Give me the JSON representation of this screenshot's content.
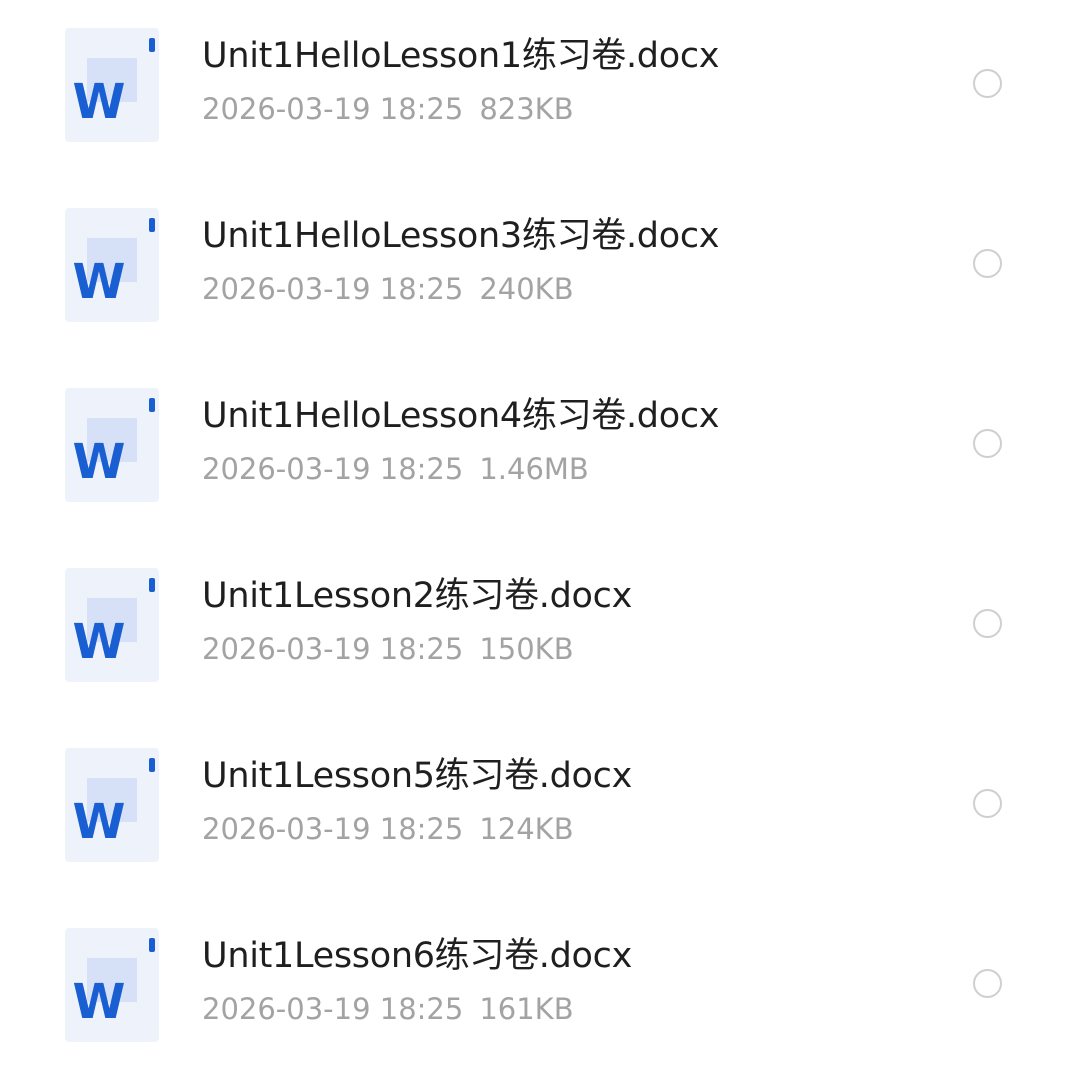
{
  "files": [
    {
      "name": "Unit1HelloLesson1练习卷.docx",
      "date": "2026-03-19 18:25",
      "size": "823KB",
      "icon": "word-document-icon",
      "icon_letter": "W"
    },
    {
      "name": "Unit1HelloLesson3练习卷.docx",
      "date": "2026-03-19 18:25",
      "size": "240KB",
      "icon": "word-document-icon",
      "icon_letter": "W"
    },
    {
      "name": "Unit1HelloLesson4练习卷.docx",
      "date": "2026-03-19 18:25",
      "size": "1.46MB",
      "icon": "word-document-icon",
      "icon_letter": "W"
    },
    {
      "name": "Unit1Lesson2练习卷.docx",
      "date": "2026-03-19 18:25",
      "size": "150KB",
      "icon": "word-document-icon",
      "icon_letter": "W"
    },
    {
      "name": "Unit1Lesson5练习卷.docx",
      "date": "2026-03-19 18:25",
      "size": "124KB",
      "icon": "word-document-icon",
      "icon_letter": "W"
    },
    {
      "name": "Unit1Lesson6练习卷.docx",
      "date": "2026-03-19 18:25",
      "size": "161KB",
      "icon": "word-document-icon",
      "icon_letter": "W"
    }
  ],
  "colors": {
    "word_blue": "#1a5fd1",
    "icon_bg": "#eef2fb",
    "name_text": "#1f1f1f",
    "meta_text": "#a3a3a3",
    "radio_border": "#cfcfcf"
  }
}
